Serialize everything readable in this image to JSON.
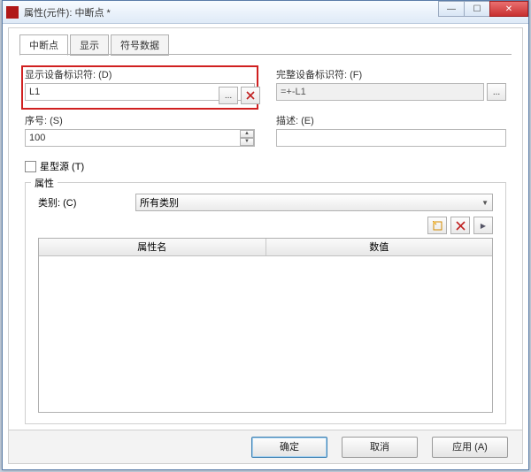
{
  "window": {
    "title": "属性(元件): 中断点 *"
  },
  "tabs": {
    "t1": "中断点",
    "t2": "显示",
    "t3": "符号数据"
  },
  "fields": {
    "display_dt_label": "显示设备标识符: (D)",
    "display_dt_value": "L1",
    "full_dt_label": "完整设备标识符: (F)",
    "full_dt_value": "=+-L1",
    "seq_label": "序号: (S)",
    "seq_value": "100",
    "desc_label": "描述: (E)",
    "desc_value": "",
    "star_label": "星型源 (T)"
  },
  "group": {
    "title": "属性",
    "cat_label": "类别: (C)",
    "cat_value": "所有类别",
    "col_name": "属性名",
    "col_value": "数值"
  },
  "buttons": {
    "ok": "确定",
    "cancel": "取消",
    "apply": "应用 (A)"
  },
  "icons": {
    "ellipsis": "...",
    "up": "▲",
    "down": "▼",
    "dropdown": "▼",
    "close": "✕",
    "min": "—",
    "max": "☐",
    "arrow_right": "▶"
  }
}
